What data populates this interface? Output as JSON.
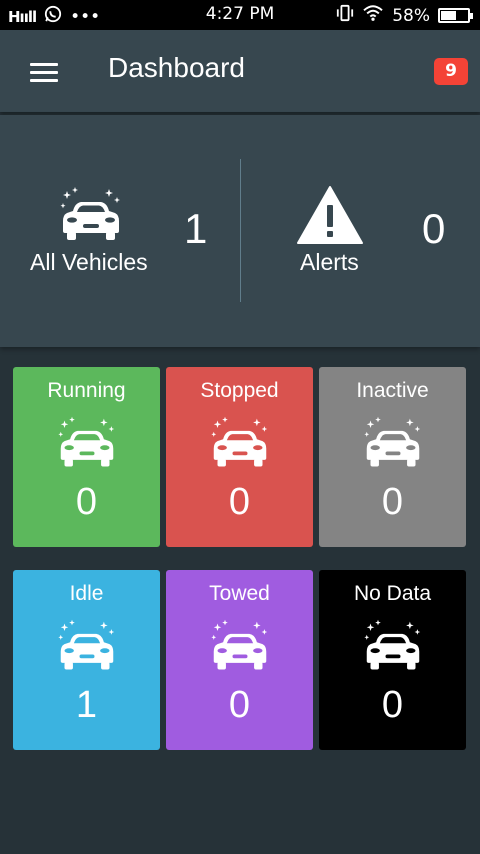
{
  "status_bar": {
    "signal": "Hııll",
    "more": "•••",
    "time": "4:27 PM",
    "battery": "58%",
    "battery_level": 0.58
  },
  "app_bar": {
    "title": "Dashboard",
    "notification_count": "9"
  },
  "summary": {
    "vehicles": {
      "label": "All Vehicles",
      "value": "1"
    },
    "alerts": {
      "label": "Alerts",
      "value": "0"
    }
  },
  "tiles": [
    {
      "label": "Running",
      "value": "0",
      "color": "#5cb85c"
    },
    {
      "label": "Stopped",
      "value": "0",
      "color": "#d9534f"
    },
    {
      "label": "Inactive",
      "value": "0",
      "color": "#848484"
    },
    {
      "label": "Idle",
      "value": "1",
      "color": "#3bb3e0"
    },
    {
      "label": "Towed",
      "value": "0",
      "color": "#a05ce0"
    },
    {
      "label": "No Data",
      "value": "0",
      "color": "#000000"
    }
  ]
}
